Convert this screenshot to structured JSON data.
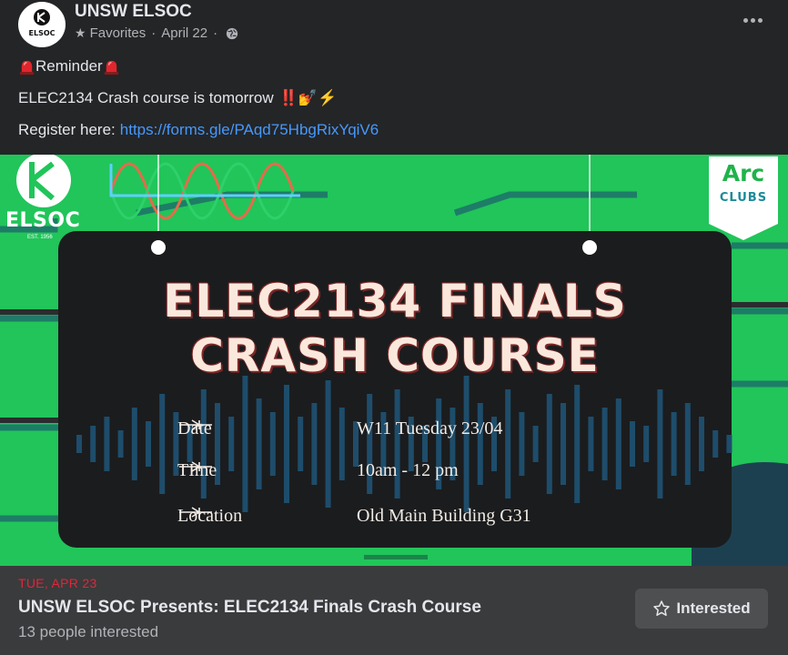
{
  "post": {
    "page_name": "UNSW ELSOC",
    "avatar_text": "ELSOC",
    "favorites_label": "Favorites",
    "separator": "·",
    "date": "April 22",
    "separator2": "·",
    "icons": {
      "favorite": "star-icon",
      "audience": "globe-icon",
      "more": "ellipsis-icon"
    }
  },
  "content": {
    "line1": "Reminder",
    "line2": "ELEC2134 Crash course is tomorrow",
    "line2_emoji": "‼️💅⚡",
    "line3_label": "Register here:",
    "line3_link": "https://forms.gle/PAqd75HbgRixYqiV6",
    "icons": {
      "reminder": "siren-icon"
    }
  },
  "poster": {
    "elsoc_logo": "ELSOC",
    "elsoc_est": "EST. 1956",
    "arc_logo": "Arc",
    "arc_clubs": "CLUBS",
    "title_line1": "ELEC2134 FINALS",
    "title_line2": "CRASH COURSE",
    "rows": [
      {
        "label": "Date",
        "value": "W11 Tuesday 23/04"
      },
      {
        "label": "TIme",
        "value": "10am - 12 pm"
      },
      {
        "label": "Location",
        "value": "Old Main Building G31"
      }
    ],
    "colors": {
      "background": "#21c55a",
      "panel": "#1b1c1e",
      "bars": "#1e4d6b",
      "title": "#fbe8dc"
    }
  },
  "event": {
    "date": "TUE, APR 23",
    "title": "UNSW ELSOC Presents: ELEC2134 Finals Crash Course",
    "interested_count": "13 people interested",
    "interested_button": "Interested",
    "colors": {
      "date": "#e0263b",
      "button": "#4e4f50"
    }
  }
}
